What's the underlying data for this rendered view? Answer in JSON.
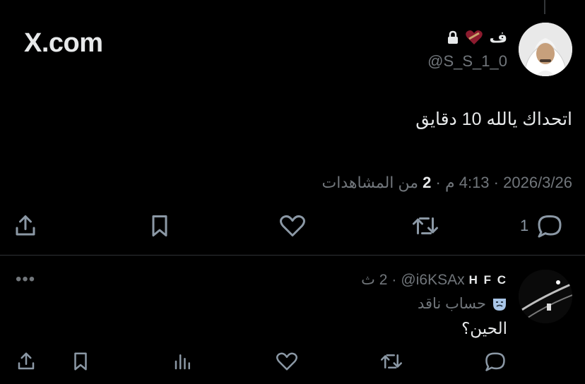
{
  "site": {
    "logo_text": "X.com"
  },
  "tweet": {
    "author_name": "ف",
    "author_handle": "@S_S_1_0",
    "text": "اتحداك يالله 10 دقايق",
    "date": "2026/3/26",
    "time": "4:13 م",
    "views_count": "2",
    "views_label": "من المشاهدات",
    "reply_count": "1"
  },
  "reply": {
    "author_name": "H F C",
    "author_handle": "@i6KSAx",
    "time_ago": "2 ث",
    "label": "حساب ناقد",
    "text": "الحين؟"
  },
  "colors": {
    "background": "#000000",
    "text": "#e7e9ea",
    "muted": "#71767b",
    "divider": "#2f3336"
  },
  "icons": [
    "share-icon",
    "bookmark-icon",
    "like-icon",
    "retweet-icon",
    "reply-icon",
    "lock-icon",
    "heart-emoji-icon",
    "mask-icon",
    "views-icon",
    "more-icon"
  ]
}
